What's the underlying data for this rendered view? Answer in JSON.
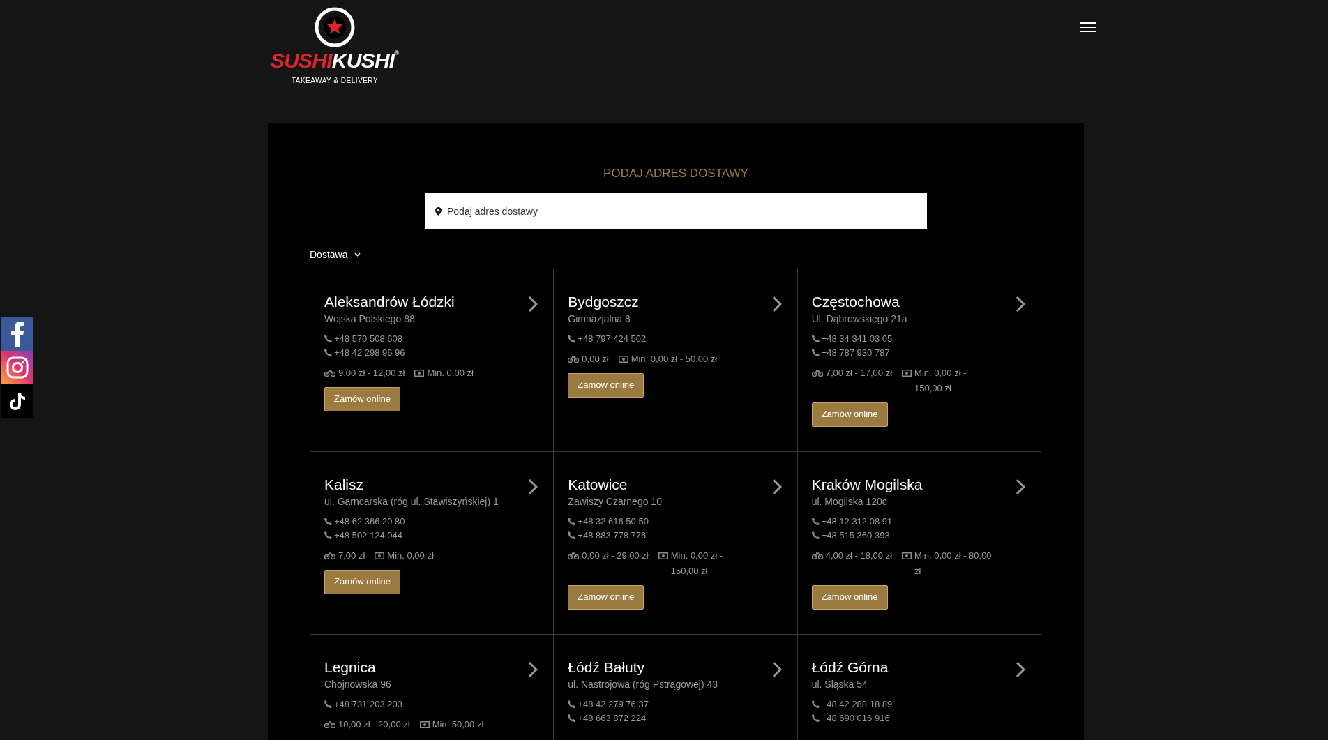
{
  "header": {
    "logo": {
      "brand_red": "SUSHI",
      "brand_white": "KUSHI",
      "registered": "®",
      "tagline": "TAKEAWAY & DELIVERY"
    }
  },
  "delivery": {
    "title": "PODAJ ADRES DOSTAWY",
    "search": {
      "placeholder": "Podaj adres dostawy"
    },
    "mode": "Dostawa"
  },
  "restaurants": [
    {
      "name": "Aleksandrów Łódzki",
      "address": "Wojska Polskiego 88",
      "phones": [
        "+48 570 508 608",
        "+48 42 298 96 96"
      ],
      "delivery_fee": "9,00 zł - 12,00 zł",
      "minimum_order": "Min. 0,00 zł",
      "button": "Zamów online"
    },
    {
      "name": "Bydgoszcz",
      "address": "Gimnazjalna 8",
      "phones": [
        "+48 797 424 502"
      ],
      "delivery_fee": "0,00 zł",
      "minimum_order": "Min. 0,00 zł - 50,00 zł",
      "button": "Zamów online"
    },
    {
      "name": "Częstochowa",
      "address": "Ul. Dąbrowskiego 21a",
      "phones": [
        "+48 34 341 03 05",
        "+48 787 930 787"
      ],
      "delivery_fee": "7,00 zł - 17,00 zł",
      "minimum_order": "Min. 0,00 zł - 150,00 zł",
      "button": "Zamów online"
    },
    {
      "name": "Kalisz",
      "address": "ul. Garncarska (róg ul. Stawiszyńskiej) 1",
      "phones": [
        "+48 62 366 20 80",
        "+48 502 124 044"
      ],
      "delivery_fee": "7,00 zł",
      "minimum_order": "Min. 0,00 zł",
      "button": "Zamów online"
    },
    {
      "name": "Katowice",
      "address": "Zawiszy Czarnego 10",
      "phones": [
        "+48 32 616 50 50",
        "+48 883 778 776"
      ],
      "delivery_fee": "0,00 zł - 29,00 zł",
      "minimum_order": "Min. 0,00 zł - 150,00 zł",
      "button": "Zamów online"
    },
    {
      "name": "Kraków Mogilska",
      "address": "ul. Mogilska 120c",
      "phones": [
        "+48 12 312 08 91",
        "+48 515 360 393"
      ],
      "delivery_fee": "4,00 zł - 18,00 zł",
      "minimum_order": "Min. 0,00 zł - 80,00 zł",
      "button": "Zamów online"
    },
    {
      "name": "Legnica",
      "address": "Chojnowska 96",
      "phones": [
        "+48 731 203 203"
      ],
      "delivery_fee": "10,00 zł - 20,00 zł",
      "minimum_order": "Min. 50,00 zł -"
    },
    {
      "name": "Łódź Bałuty",
      "address": "ul. Nastrojowa (róg Pstrągowej) 43",
      "phones": [
        "+48 42 279 76 37",
        "+48 663 872 224"
      ]
    },
    {
      "name": "Łódź Górna",
      "address": "ul. Śląska 54",
      "phones": [
        "+48 42 288 18 89",
        "+48 690 016 916"
      ]
    }
  ]
}
